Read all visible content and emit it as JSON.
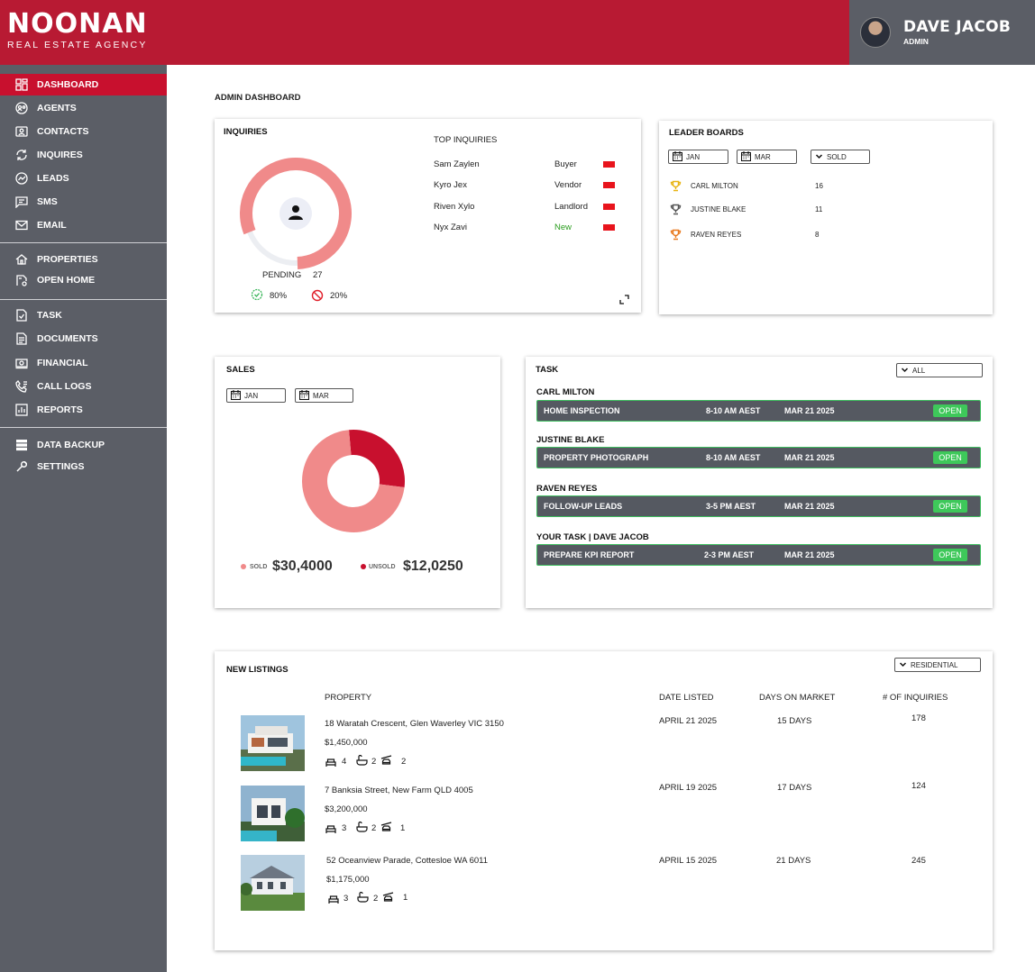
{
  "brand": {
    "name": "NOONAN",
    "tagline": "REAL ESTATE AGENCY",
    "accent": "#b81a33"
  },
  "user": {
    "name": "DAVE JACOB",
    "role": "ADMIN"
  },
  "sidebar": {
    "group1": [
      {
        "label": "DASHBOARD",
        "icon": "dashboard-icon"
      },
      {
        "label": "AGENTS",
        "icon": "agents-icon"
      },
      {
        "label": "CONTACTS",
        "icon": "contacts-icon"
      },
      {
        "label": "INQUIRES",
        "icon": "inquiries-icon"
      },
      {
        "label": "LEADS",
        "icon": "leads-icon"
      },
      {
        "label": "SMS",
        "icon": "sms-icon"
      },
      {
        "label": "EMAIL",
        "icon": "email-icon"
      }
    ],
    "group2": [
      {
        "label": "PROPERTIES",
        "icon": "properties-icon"
      },
      {
        "label": "OPEN HOME",
        "icon": "open-home-icon"
      }
    ],
    "group3": [
      {
        "label": "TASK",
        "icon": "task-icon"
      },
      {
        "label": "DOCUMENTS",
        "icon": "documents-icon"
      },
      {
        "label": "FINANCIAL",
        "icon": "financial-icon"
      },
      {
        "label": "CALL LOGS",
        "icon": "call-logs-icon"
      },
      {
        "label": "REPORTS",
        "icon": "reports-icon"
      }
    ],
    "group4": [
      {
        "label": "DATA BACKUP",
        "icon": "data-backup-icon"
      },
      {
        "label": "SETTINGS",
        "icon": "settings-icon"
      }
    ]
  },
  "page_title": "ADMIN DASHBOARD",
  "inquiries": {
    "title": "INQUIRIES",
    "pending_label": "PENDING",
    "pending_value": "27",
    "approved_pct": "80%",
    "rejected_pct": "20%",
    "gauge_fraction": 0.8,
    "top_title": "TOP INQUIRIES",
    "top": [
      {
        "name": "Sam Zaylen",
        "type": "Buyer"
      },
      {
        "name": "Kyro Jex",
        "type": "Vendor"
      },
      {
        "name": "Riven Xylo",
        "type": "Landlord"
      },
      {
        "name": "Nyx Zavi",
        "type": "New"
      }
    ]
  },
  "leaderboard": {
    "title": "LEADER BOARDS",
    "from": "JAN",
    "to": "MAR",
    "filter": "SOLD",
    "rows": [
      {
        "name": "CARL MILTON",
        "value": "16",
        "trophy": "gold"
      },
      {
        "name": "JUSTINE BLAKE",
        "value": "11",
        "trophy": "silver"
      },
      {
        "name": "RAVEN REYES",
        "value": "8",
        "trophy": "bronze"
      }
    ]
  },
  "sales": {
    "title": "SALES",
    "from": "JAN",
    "to": "MAR",
    "sold_label": "SOLD",
    "sold_value": "$30,4000",
    "unsold_label": "UNSOLD",
    "unsold_value": "$12,0250"
  },
  "chart_data": {
    "type": "pie",
    "labels": [
      "SOLD",
      "UNSOLD"
    ],
    "values": [
      304000,
      120250
    ],
    "colors": [
      "#f08a8a",
      "#c8102e"
    ]
  },
  "task": {
    "title": "TASK",
    "filter": "ALL",
    "groups": [
      {
        "owner": "CARL MILTON",
        "task": "HOME INSPECTION",
        "time": "8-10 AM AEST",
        "date": "MAR 21 2025",
        "status": "OPEN"
      },
      {
        "owner": "JUSTINE BLAKE",
        "task": "PROPERTY PHOTOGRAPH",
        "time": "8-10 AM AEST",
        "date": "MAR 21 2025",
        "status": "OPEN"
      },
      {
        "owner": "RAVEN REYES",
        "task": "FOLLOW-UP LEADS",
        "time": "3-5 PM AEST",
        "date": "MAR 21 2025",
        "status": "OPEN"
      },
      {
        "owner": "YOUR TASK | DAVE JACOB",
        "task": "PREPARE KPI REPORT",
        "time": "2-3 PM AEST",
        "date": "MAR 21 2025",
        "status": "OPEN"
      }
    ]
  },
  "listings": {
    "title": "NEW LISTINGS",
    "filter": "RESIDENTIAL",
    "headers": [
      "PROPERTY",
      "DATE LISTED",
      "DAYS ON MARKET",
      "# OF INQUIRIES"
    ],
    "rows": [
      {
        "address": "18 Waratah Crescent, Glen Waverley VIC 3150",
        "price": "$1,450,000",
        "beds": "4",
        "baths": "2",
        "cars": "2",
        "date": "APRIL 21 2025",
        "days": "15 DAYS",
        "inquiries": "178"
      },
      {
        "address": "7 Banksia Street, New Farm QLD 4005",
        "price": "$3,200,000",
        "beds": "3",
        "baths": "2",
        "cars": "1",
        "date": "APRIL 19 2025",
        "days": "17 DAYS",
        "inquiries": "124"
      },
      {
        "address": "52 Oceanview Parade, Cottesloe WA 6011",
        "price": "$1,175,000",
        "beds": "3",
        "baths": "2",
        "cars": "1",
        "date": "APRIL 15 2025",
        "days": "21 DAYS",
        "inquiries": "245"
      }
    ]
  }
}
